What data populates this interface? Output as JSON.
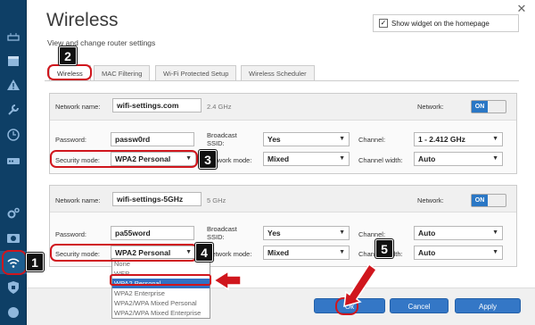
{
  "page": {
    "title": "Wireless",
    "subtitle": "View and change router settings"
  },
  "widget": {
    "checkbox_label": "Show widget on the homepage",
    "checked": true
  },
  "tabs": [
    {
      "label": "Wireless",
      "active": true
    },
    {
      "label": "MAC Filtering"
    },
    {
      "label": "Wi-Fi Protected Setup"
    },
    {
      "label": "Wireless Scheduler"
    }
  ],
  "network_24": {
    "name_label": "Network name:",
    "name_value": "wifi-settings.com",
    "band": "2.4 GHz",
    "network_label": "Network:",
    "toggle": "ON",
    "password_label": "Password:",
    "password_value": "passw0rd",
    "broadcast_label": "Broadcast SSID:",
    "broadcast_value": "Yes",
    "channel_label": "Channel:",
    "channel_value": "1 - 2.412 GHz",
    "security_label": "Security mode:",
    "security_value": "WPA2 Personal",
    "mode_label": "Network mode:",
    "mode_value": "Mixed",
    "width_label": "Channel width:",
    "width_value": "Auto"
  },
  "network_5": {
    "name_label": "Network name:",
    "name_value": "wifi-settings-5GHz",
    "band": "5 GHz",
    "network_label": "Network:",
    "toggle": "ON",
    "password_label": "Password:",
    "password_value": "pa55word",
    "broadcast_label": "Broadcast SSID:",
    "broadcast_value": "Yes",
    "channel_label": "Channel:",
    "channel_value": "Auto",
    "security_label": "Security mode:",
    "security_value": "WPA2 Personal",
    "mode_label": "Network mode:",
    "mode_value": "Mixed",
    "width_label": "Channel width:",
    "width_value": "Auto"
  },
  "security_options": [
    "None",
    "WEP",
    "WPA2 Personal",
    "WPA2 Enterprise",
    "WPA2/WPA Mixed Personal",
    "WPA2/WPA Mixed Enterprise"
  ],
  "selected_security_option": "WPA2 Personal",
  "buttons": {
    "ok": "Ok",
    "cancel": "Cancel",
    "apply": "Apply"
  },
  "callouts": [
    "2",
    "3",
    "4",
    "5",
    "1"
  ],
  "colors": {
    "sidebar": "#0e3f66",
    "accent": "#2a77c5",
    "highlight": "#d0161d"
  },
  "sidebar_icons": [
    "network-map-icon",
    "calendar-icon",
    "warning-icon",
    "wrench-icon",
    "clock-icon",
    "router-icon",
    "gear-icon",
    "camera-icon",
    "wifi-icon",
    "shield-icon",
    "globe-icon"
  ]
}
